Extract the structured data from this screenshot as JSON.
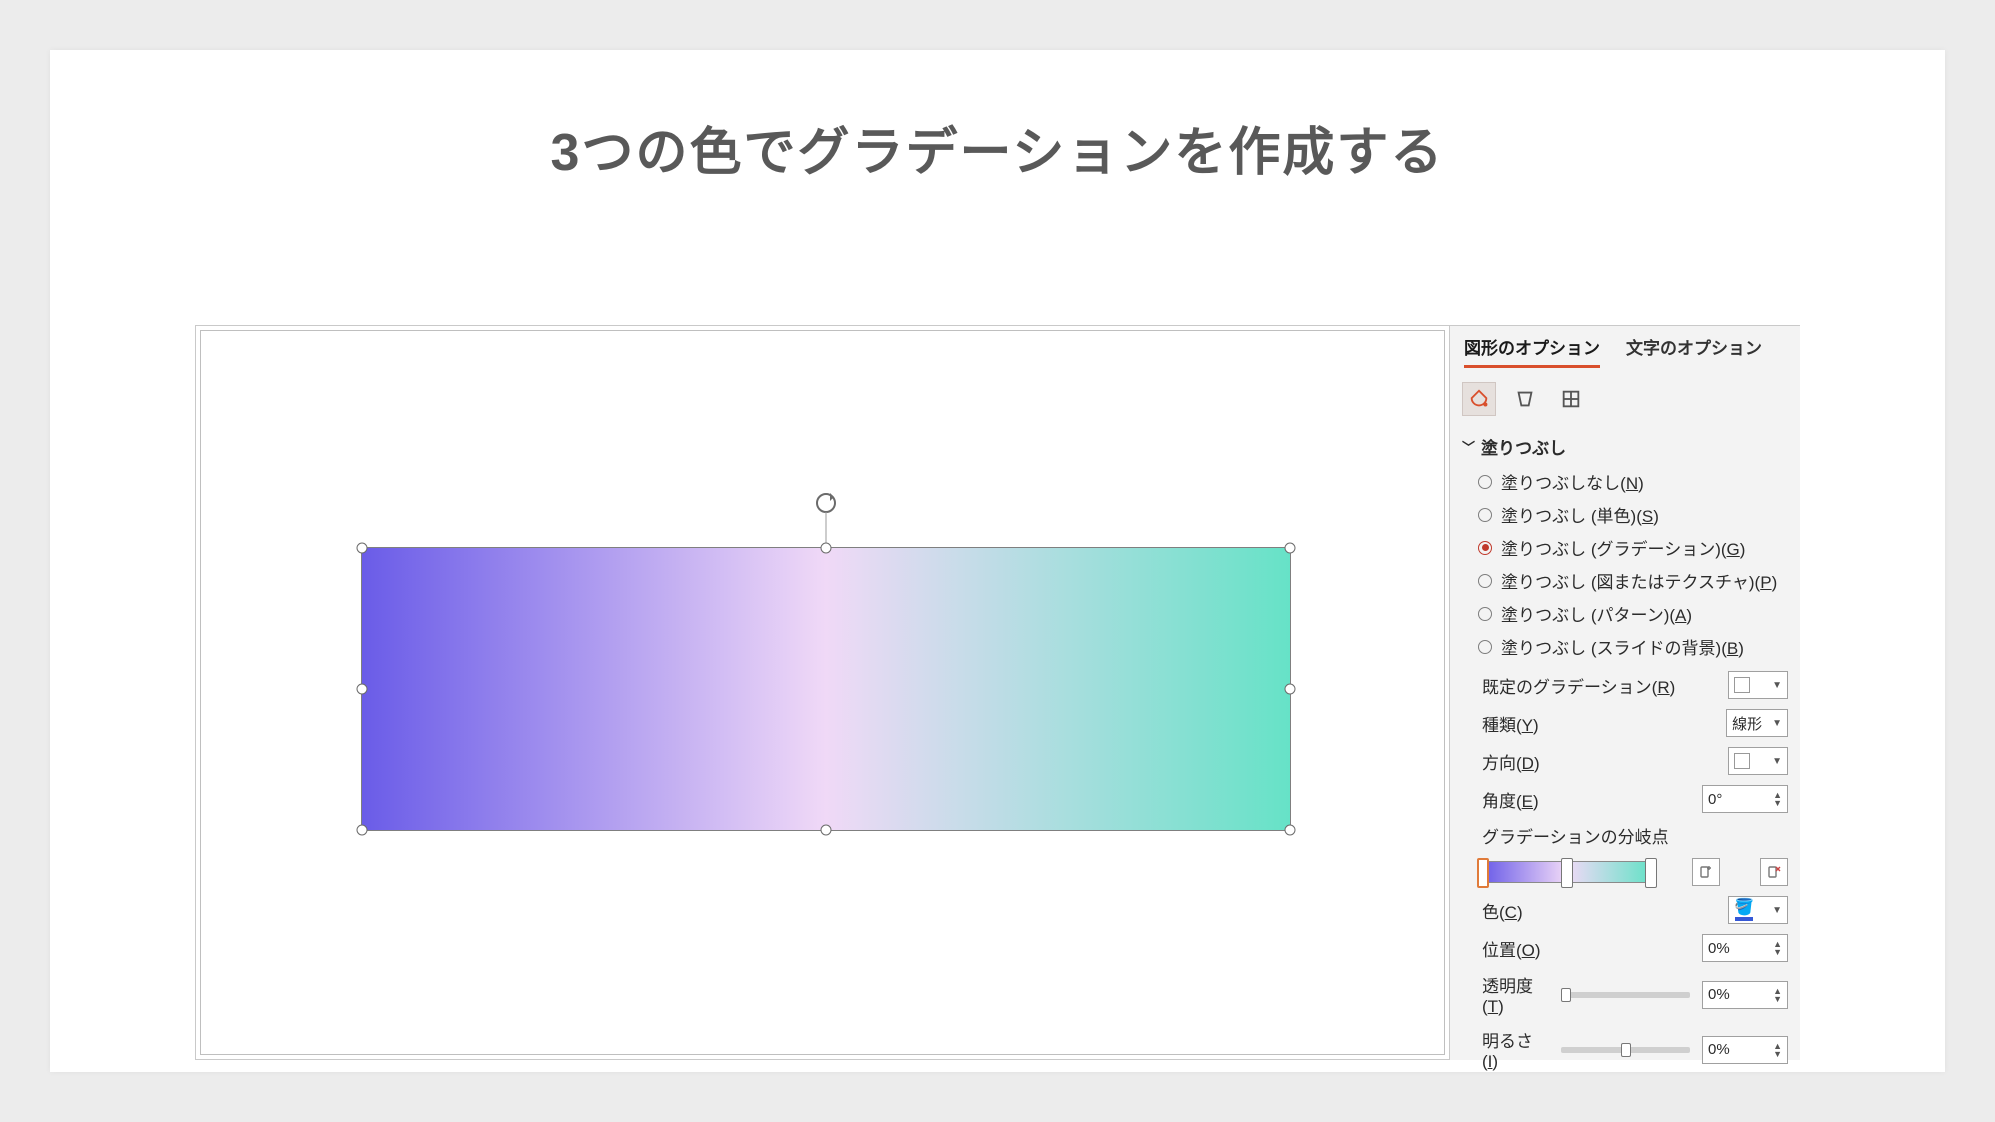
{
  "title": "3つの色でグラデーションを作成する",
  "panel": {
    "tabs": {
      "shape": "図形のオプション",
      "text": "文字のオプション"
    },
    "section_fill": "塗りつぶし",
    "fill_options": {
      "none": "塗りつぶしなし",
      "none_key": "N",
      "solid": "塗りつぶし (単色)",
      "solid_key": "S",
      "grad": "塗りつぶし (グラデーション)",
      "grad_key": "G",
      "pict": "塗りつぶし (図またはテクスチャ)",
      "pict_key": "P",
      "patt": "塗りつぶし (パターン)",
      "patt_key": "A",
      "slide": "塗りつぶし (スライドの背景)",
      "slide_key": "B"
    },
    "props": {
      "preset": "既定のグラデーション",
      "preset_key": "R",
      "type": "種類",
      "type_key": "Y",
      "type_value": "線形",
      "direction": "方向",
      "direction_key": "D",
      "angle": "角度",
      "angle_key": "E",
      "angle_value": "0°",
      "stops": "グラデーションの分岐点",
      "color": "色",
      "color_key": "C",
      "position": "位置",
      "position_key": "O",
      "position_value": "0%",
      "transparency": "透明度",
      "transparency_key": "T",
      "transparency_value": "0%",
      "brightness": "明るさ",
      "brightness_key": "I",
      "brightness_value": "0%"
    }
  },
  "gradient": {
    "stops": [
      {
        "pos": 0,
        "color": "#6a5ce8",
        "selected": true
      },
      {
        "pos": 50,
        "color": "#f0d9f7",
        "selected": false
      },
      {
        "pos": 100,
        "color": "#66e2c7",
        "selected": false
      }
    ]
  }
}
